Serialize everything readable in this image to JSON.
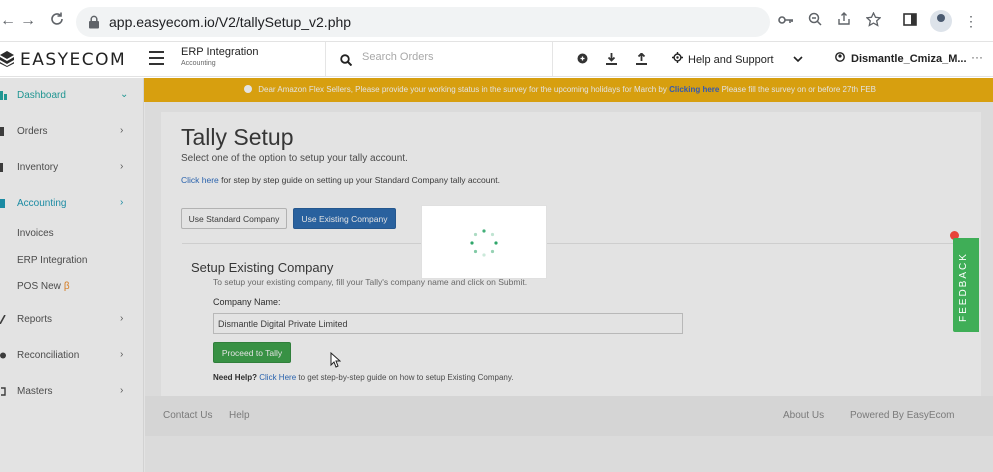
{
  "browser": {
    "url": "app.easyecom.io/V2/tallySetup_v2.php",
    "icons": [
      "back-icon",
      "forward-icon",
      "reload-icon",
      "lock-icon",
      "key-icon",
      "zoom-icon",
      "share-icon",
      "star-icon",
      "sidebar-icon",
      "profile-icon",
      "menu-icon"
    ]
  },
  "header": {
    "logo": "EASYECOM",
    "context_title": "ERP Integration",
    "context_subtitle": "Accounting",
    "search_placeholder": "Search Orders",
    "help": "Help and Support",
    "user": "Dismantle_Cmiza_M...",
    "more": "···"
  },
  "notice": {
    "text_before": "Dear Amazon Flex Sellers, Please provide your working status in the survey for the upcoming holidays for March by",
    "link": "Clicking here",
    "text_after": "Please fill the survey on or before 27th FEB"
  },
  "sidebar": {
    "items": [
      {
        "label": "Dashboard"
      },
      {
        "label": "Orders"
      },
      {
        "label": "Inventory"
      },
      {
        "label": "Accounting"
      },
      {
        "label": "Reports"
      },
      {
        "label": "Reconciliation"
      },
      {
        "label": "Masters"
      }
    ],
    "sub_items": [
      {
        "label": "Invoices"
      },
      {
        "label": "ERP Integration"
      },
      {
        "label": "POS New",
        "badge": "β"
      }
    ]
  },
  "main": {
    "title": "Tally Setup",
    "subtitle": "Select one of the option to setup your tally account.",
    "guide_link": "Click here",
    "guide_text": "for step by step guide on setting up your Standard Company tally account.",
    "btn_standard": "Use Standard Company",
    "btn_existing": "Use Existing Company",
    "section_title": "Setup Existing Company",
    "section_help": "To setup your existing company, fill your Tally's company name and click on Submit.",
    "company_label": "Company Name:",
    "company_value": "Dismantle Digital Private Limited",
    "btn_proceed": "Proceed to Tally",
    "need_help_bold": "Need Help?",
    "need_help_link": "Click Here",
    "need_help_text": "to get step-by-step guide on how to setup Existing Company."
  },
  "footer": {
    "contact": "Contact Us",
    "help": "Help",
    "about": "About Us",
    "powered": "Powered By EasyEcom"
  },
  "feedback": "FEEDBACK",
  "colors": {
    "accent_teal": "#25a9a5",
    "notice_yellow": "#f2b311",
    "primary_blue": "#2f6db2",
    "success_green": "#3fa34d",
    "feedback_green": "#3fae57"
  }
}
